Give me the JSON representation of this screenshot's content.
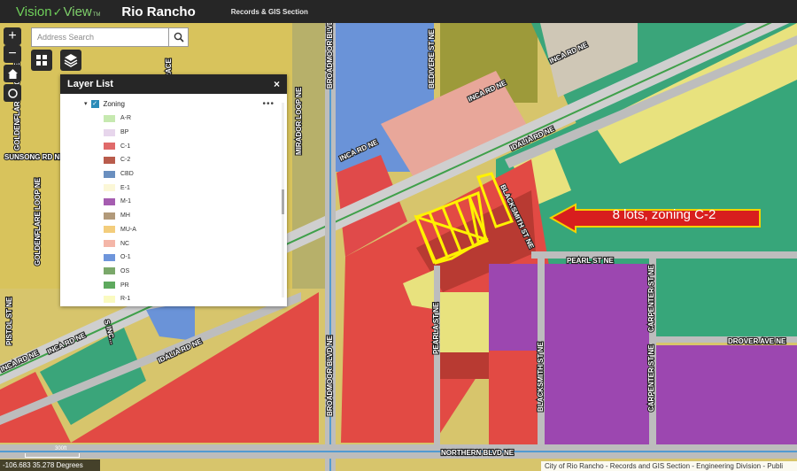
{
  "header": {
    "logo_part1": "Vision",
    "logo_part2": "View",
    "logo_tm": "TM",
    "app_name": "Rio Rancho",
    "section": "Records & GIS Section"
  },
  "search": {
    "placeholder": "Address Search",
    "icon": "search-icon"
  },
  "controls": {
    "zoom_in": "+",
    "zoom_out": "−",
    "basemap_icon": "grid-icon",
    "layers_icon": "layers-icon",
    "home_icon": "home-icon",
    "locate_icon": "locate-icon"
  },
  "layer_list": {
    "title": "Layer List",
    "close": "×",
    "group": {
      "label": "Zoning",
      "checked": true,
      "more": "•••"
    },
    "items": [
      {
        "label": "A-R",
        "color": "#c6e9b0"
      },
      {
        "label": "BP",
        "color": "#e7d6ec"
      },
      {
        "label": "C-1",
        "color": "#e06a6a"
      },
      {
        "label": "C-2",
        "color": "#b95c4c"
      },
      {
        "label": "CBD",
        "color": "#6a8fbf"
      },
      {
        "label": "E-1",
        "color": "#fbf7d7"
      },
      {
        "label": "M-1",
        "color": "#a55db0"
      },
      {
        "label": "MH",
        "color": "#b29a7a"
      },
      {
        "label": "MU-A",
        "color": "#f3cd7c"
      },
      {
        "label": "NC",
        "color": "#f4b6a8"
      },
      {
        "label": "O-1",
        "color": "#6e95db"
      },
      {
        "label": "OS",
        "color": "#7aa86a"
      },
      {
        "label": "PR",
        "color": "#5ea95e"
      },
      {
        "label": "R-1",
        "color": "#fafac0"
      }
    ]
  },
  "callout": {
    "text": "8 lots, zoning C-2",
    "color": "#d81e1e"
  },
  "road_labels": {
    "inca_top": "INCA RD NE",
    "inca_mid": "INCA RD NE",
    "inca_left": "INCA RD NE",
    "inca_far_left": "INCA RD NE",
    "idalia_right": "IDALIA RD NE",
    "idalia_left": "IDALIA RD NE",
    "broadmoor_top": "BROADMOOR BLVD NE",
    "broadmoor_bottom": "BROADMOOR BLVD NE",
    "bedivere": "BEDIVERE ST NE",
    "sunsong": "SUNSONG RD NE",
    "goldenflare_top": "GOLDENFLARE LOOP NE",
    "goldenflare_bottom": "GOLDENFLARE LOOP NE",
    "mirador": "MIRADOR LOOP NE",
    "grace": "GRACE",
    "blacksmith_top": "BLACKSMITH ST NE",
    "blacksmith_bottom": "BLACKSMITH ST NE",
    "pearl_st": "PEARL ST NE",
    "pearla_st": "PEARLA ST NE",
    "carpenter_top": "CARPENTER ST NE",
    "carpenter_bottom": "CARPENTER ST NE",
    "drover": "DROVER AVE NE",
    "northern": "NORTHERN BLVD NE",
    "pistol": "PISTOL ST NE",
    "sinc": "S INC..."
  },
  "status": {
    "coordinates": "-106.683 35.278 Degrees",
    "scale": "300ft",
    "attribution": "City of Rio Rancho - Records and GIS Section - Engineering Division - Publi"
  }
}
